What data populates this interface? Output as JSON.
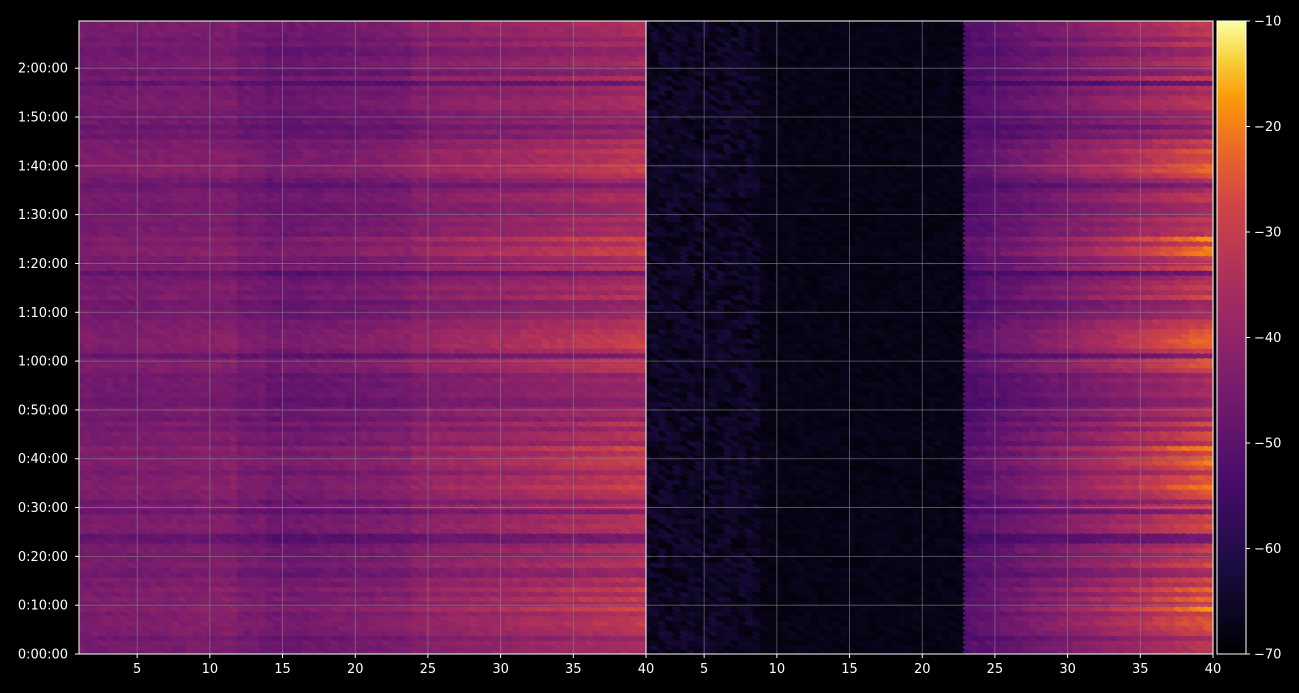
{
  "chart_data": {
    "type": "heatmap",
    "title": "",
    "panels": [
      {
        "name": "",
        "x_range": [
          1,
          40
        ],
        "x_ticks": [
          "5",
          "10",
          "15",
          "20",
          "25",
          "30",
          "35",
          "40"
        ]
      },
      {
        "name": "",
        "x_range": [
          1,
          40
        ],
        "x_ticks": [
          "5",
          "10",
          "15",
          "20",
          "25",
          "30",
          "35",
          "40"
        ]
      }
    ],
    "xlabel": "",
    "ylabel": "",
    "y_range_seconds": [
      0,
      7780
    ],
    "y_ticks": [
      "0:00:00",
      "0:10:00",
      "0:20:00",
      "0:30:00",
      "0:40:00",
      "0:50:00",
      "1:00:00",
      "1:10:00",
      "1:20:00",
      "1:30:00",
      "1:40:00",
      "1:50:00",
      "2:00:00"
    ],
    "grid": true,
    "colormap": "inferno",
    "colorbar": {
      "range": [
        -70,
        -10
      ],
      "ticks": [
        "−70",
        "−60",
        "−50",
        "−40",
        "−30",
        "−20",
        "−10"
      ]
    },
    "description": "Dense hex-binned heatmap; left panel shows high intensity throughout, increasing toward x=40; right panel is dark for x<24 and bright for x>24."
  },
  "colors": {
    "background": "#000000",
    "axis": "#ffffff",
    "grid": "#888888"
  }
}
